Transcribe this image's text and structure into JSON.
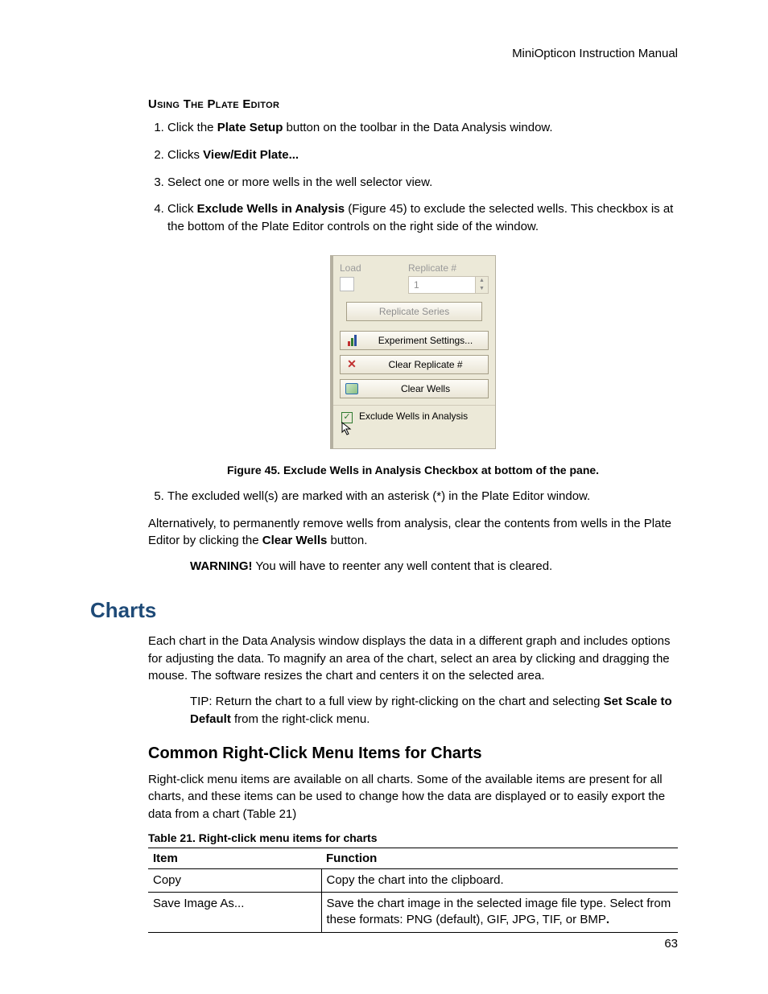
{
  "header": {
    "running": "MiniOpticon Instruction Manual"
  },
  "plateEditor": {
    "heading": "Using The Plate Editor",
    "items": [
      {
        "pre": "Click the ",
        "b": "Plate Setup",
        "post": " button on the toolbar in the Data Analysis window."
      },
      {
        "pre": "Clicks ",
        "b": "View/Edit Plate...",
        "post": ""
      },
      {
        "pre": "Select one or more wells in the well selector view.",
        "b": "",
        "post": ""
      },
      {
        "pre": "Click ",
        "b": "Exclude Wells in Analysis",
        "post": " (Figure 45) to exclude the selected wells. This checkbox is at the bottom of the Plate Editor controls on the right side of the window."
      }
    ],
    "step5": {
      "pre": "The excluded well(s) are marked with an asterisk (*) in the Plate Editor window."
    }
  },
  "panel": {
    "loadLabel": "Load",
    "replicateLabel": "Replicate #",
    "replicateValue": "1",
    "replicateSeries": "Replicate Series",
    "experiment": "Experiment Settings...",
    "clearRep": "Clear Replicate #",
    "clearWells": "Clear Wells",
    "exclude": "Exclude Wells in Analysis"
  },
  "figCaption": "Figure 45. Exclude Wells in Analysis Checkbox at bottom of the pane.",
  "altPara": {
    "pre": "Alternatively, to permanently remove wells from analysis, clear the contents from wells in the Plate Editor by clicking the ",
    "b": "Clear Wells",
    "post": " button."
  },
  "warning": {
    "b": "WARNING!",
    "post": " You will have to reenter any well content that is cleared."
  },
  "charts": {
    "heading": "Charts",
    "intro": "Each chart in the Data Analysis window displays the data in a different graph and includes options for adjusting the data. To magnify an area of the chart, select an area by clicking and dragging the mouse. The software resizes the chart and centers it on the selected area.",
    "tip": {
      "pre": "TIP: Return the chart to a full view by right-clicking on the chart and selecting ",
      "b1": "Set Scale to Default",
      "post": " from the right-click menu."
    },
    "subHeading": "Common Right-Click Menu Items for Charts",
    "subPara": "Right-click menu items are available on all charts. Some of the available items are present for all charts, and these items can be used to change how the data are displayed or to easily export the data from a chart (Table 21)"
  },
  "table": {
    "caption": "Table 21. Right-click menu items for charts",
    "head": {
      "c1": "Item",
      "c2": "Function"
    },
    "rows": [
      {
        "c1": "Copy",
        "c2": "Copy the chart into the clipboard."
      },
      {
        "c1": "Save Image As...",
        "c2pre": "Save the chart image in the selected image file type. Select from these formats: PNG (default), GIF, JPG, TIF, or BMP",
        "c2b": "."
      }
    ]
  },
  "pageNumber": "63"
}
